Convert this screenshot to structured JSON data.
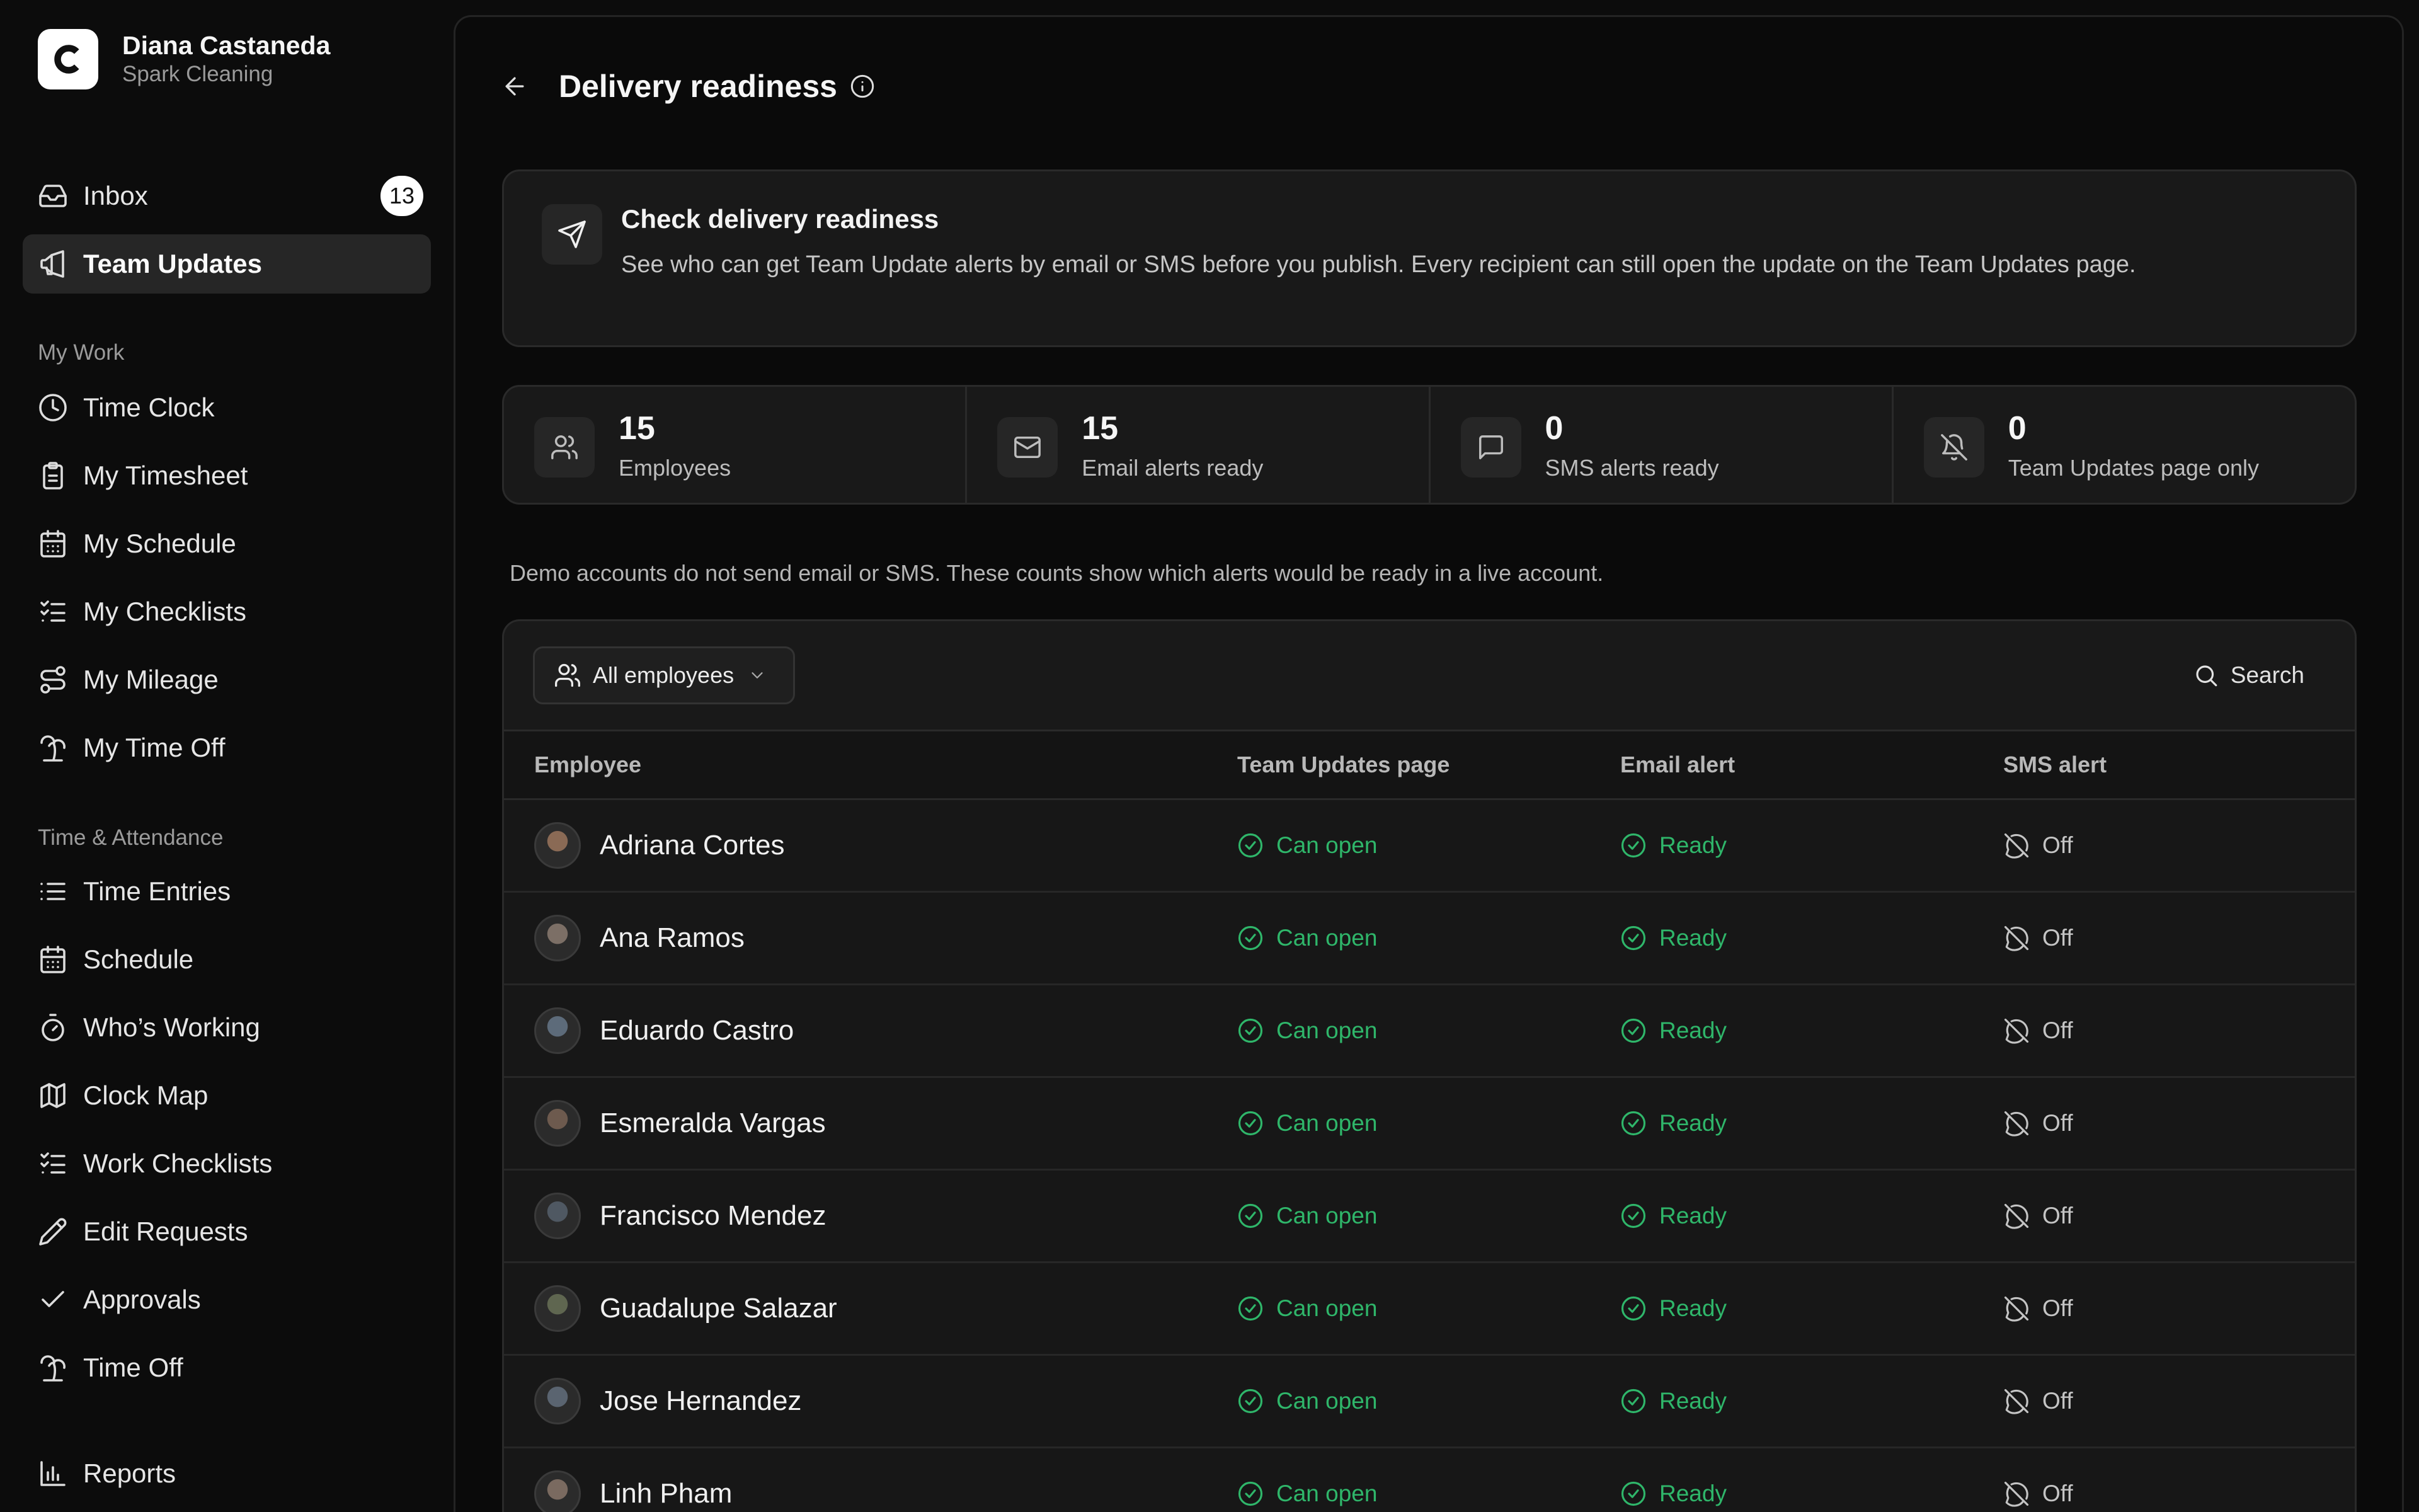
{
  "profile": {
    "name": "Diana Castaneda",
    "company": "Spark Cleaning"
  },
  "nav": {
    "primary": [
      {
        "label": "Inbox",
        "icon": "inbox-icon",
        "badge": "13"
      },
      {
        "label": "Team Updates",
        "icon": "megaphone-icon",
        "active": true
      }
    ],
    "my_work": {
      "heading": "My Work",
      "items": [
        {
          "label": "Time Clock",
          "icon": "clock-icon"
        },
        {
          "label": "My Timesheet",
          "icon": "clipboard-icon"
        },
        {
          "label": "My Schedule",
          "icon": "calendar-icon"
        },
        {
          "label": "My Checklists",
          "icon": "checklist-icon"
        },
        {
          "label": "My Mileage",
          "icon": "route-icon"
        },
        {
          "label": "My Time Off",
          "icon": "palm-tree-icon"
        }
      ]
    },
    "time_attendance": {
      "heading": "Time & Attendance",
      "items": [
        {
          "label": "Time Entries",
          "icon": "list-icon"
        },
        {
          "label": "Schedule",
          "icon": "calendar-icon"
        },
        {
          "label": "Who’s Working",
          "icon": "stopwatch-icon"
        },
        {
          "label": "Clock Map",
          "icon": "map-icon"
        },
        {
          "label": "Work Checklists",
          "icon": "checklist-icon"
        },
        {
          "label": "Edit Requests",
          "icon": "pencil-icon"
        },
        {
          "label": "Approvals",
          "icon": "check-icon"
        },
        {
          "label": "Time Off",
          "icon": "palm-tree-icon"
        }
      ]
    },
    "reports": {
      "label": "Reports",
      "icon": "bar-chart-icon"
    }
  },
  "header": {
    "title": "Delivery readiness"
  },
  "notice": {
    "title": "Check delivery readiness",
    "description": "See who can get Team Update alerts by email or SMS before you publish. Every recipient can still open the update on the Team Updates page."
  },
  "stats": [
    {
      "value": "15",
      "label": "Employees",
      "icon": "users-icon"
    },
    {
      "value": "15",
      "label": "Email alerts ready",
      "icon": "mail-icon"
    },
    {
      "value": "0",
      "label": "SMS alerts ready",
      "icon": "message-icon"
    },
    {
      "value": "0",
      "label": "Team Updates page only",
      "icon": "bell-off-icon"
    }
  ],
  "demo_note": "Demo accounts do not send email or SMS. These counts show which alerts would be ready in a live account.",
  "toolbar": {
    "filter_label": "All employees",
    "search_label": "Search"
  },
  "table": {
    "columns": [
      "Employee",
      "Team Updates page",
      "Email alert",
      "SMS alert"
    ],
    "rows": [
      {
        "name": "Adriana Cortes",
        "page": "Can open",
        "email": "Ready",
        "sms": "Off"
      },
      {
        "name": "Ana Ramos",
        "page": "Can open",
        "email": "Ready",
        "sms": "Off"
      },
      {
        "name": "Eduardo Castro",
        "page": "Can open",
        "email": "Ready",
        "sms": "Off"
      },
      {
        "name": "Esmeralda Vargas",
        "page": "Can open",
        "email": "Ready",
        "sms": "Off"
      },
      {
        "name": "Francisco Mendez",
        "page": "Can open",
        "email": "Ready",
        "sms": "Off"
      },
      {
        "name": "Guadalupe Salazar",
        "page": "Can open",
        "email": "Ready",
        "sms": "Off"
      },
      {
        "name": "Jose Hernandez",
        "page": "Can open",
        "email": "Ready",
        "sms": "Off"
      },
      {
        "name": "Linh Pham",
        "page": "Can open",
        "email": "Ready",
        "sms": "Off"
      }
    ]
  },
  "colors": {
    "success": "#2fb66a",
    "accent_bg": "#191919",
    "border": "#2a2a2a"
  }
}
